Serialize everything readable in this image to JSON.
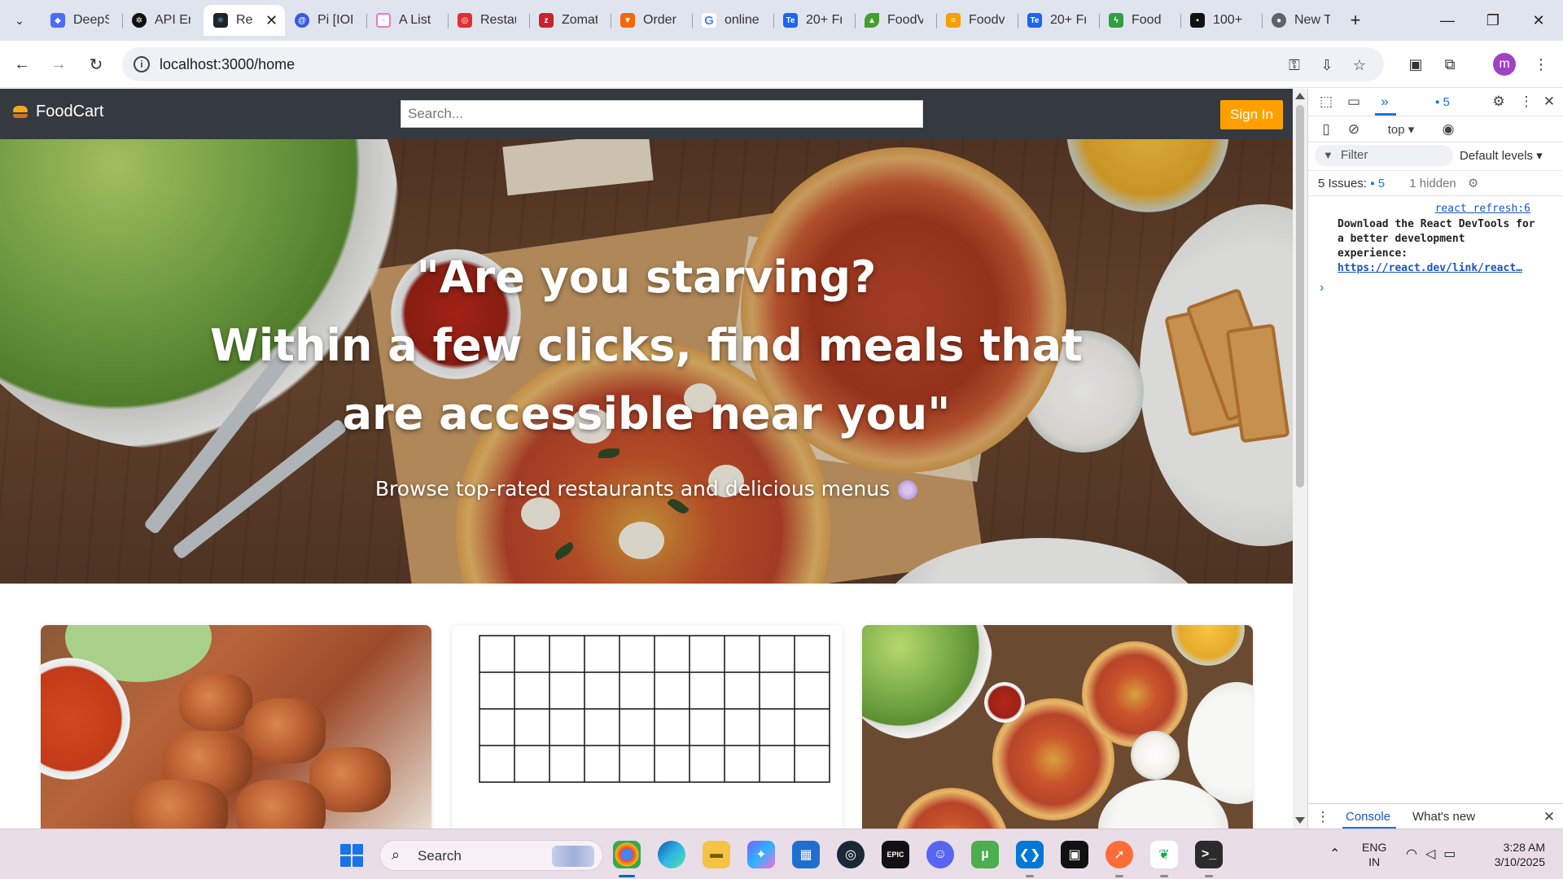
{
  "browser": {
    "tabs": [
      {
        "title": "DeepS",
        "favicon": "deepseek-icon",
        "color": "#4d6bfe"
      },
      {
        "title": "API Er",
        "favicon": "openai-icon",
        "color": "#111111"
      },
      {
        "title": "Re",
        "favicon": "react-icon",
        "color": "#20232a",
        "active": true
      },
      {
        "title": "Pi [IOI",
        "favicon": "pi-icon",
        "color": "#3b5bdb"
      },
      {
        "title": "A List",
        "favicon": "list-icon",
        "color": "#e879c6"
      },
      {
        "title": "Restau",
        "favicon": "restaurant-icon",
        "color": "#e03131"
      },
      {
        "title": "Zomat",
        "favicon": "zomato-icon",
        "color": "#cb202d"
      },
      {
        "title": "Order",
        "favicon": "order-icon",
        "color": "#f76707"
      },
      {
        "title": "online",
        "favicon": "google-icon",
        "color": "#4285f4"
      },
      {
        "title": "20+ Fr",
        "favicon": "te-icon",
        "color": "#1c64f2"
      },
      {
        "title": "FoodV",
        "favicon": "leaf-icon",
        "color": "#40a02b"
      },
      {
        "title": "Foodv",
        "favicon": "burger-icon",
        "color": "#f59f00"
      },
      {
        "title": "20+ Fr",
        "favicon": "te-icon",
        "color": "#1c64f2"
      },
      {
        "title": "Food",
        "favicon": "bolt-icon",
        "color": "#2f9e44"
      },
      {
        "title": "100+",
        "favicon": "unsplash-icon",
        "color": "#111111"
      },
      {
        "title": "New T",
        "favicon": "chrome-icon",
        "color": "#5f6368"
      }
    ],
    "active_tab_close": "✕",
    "new_tab": "+",
    "url": "localhost:3000/home",
    "profile_initial": "m"
  },
  "app": {
    "brand": "FoodCart",
    "search_placeholder": "Search...",
    "signin_label": "Sign In",
    "hero_title_lines": [
      "\"Are you starving?",
      "Within a few clicks, find meals that",
      "are accessible near you\""
    ],
    "hero_subtitle": "Browse top-rated restaurants and delicious menus"
  },
  "devtools": {
    "issues_count": "5",
    "context": "top ▾",
    "filter_placeholder": "Filter",
    "levels": "Default levels ▾",
    "issues_label": "5 Issues:",
    "issues_badge": "5",
    "hidden_label": "1 hidden",
    "source_link": "react refresh:6",
    "message": "Download the React DevTools for a better development experience:",
    "message_link": "https://react.dev/link/react…",
    "drawer_tabs": [
      "Console",
      "What's new"
    ]
  },
  "taskbar": {
    "search_label": "Search",
    "lang_line1": "ENG",
    "lang_line2": "IN",
    "time": "3:28 AM",
    "date": "3/10/2025"
  }
}
